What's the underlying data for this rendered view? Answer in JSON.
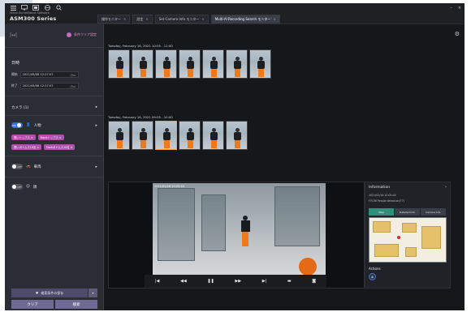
{
  "app": {
    "vendor": "Video Surveillance Software",
    "product": "ASM300 Series"
  },
  "tabs": [
    {
      "label": "操作モニター"
    },
    {
      "label": "設定"
    },
    {
      "label": "Set Camera Info モニター"
    },
    {
      "label": "Multi-AI Recording Search モニター"
    }
  ],
  "left_panel": {
    "clear_conditions": "条件クリア設定",
    "datetime_heading": "日時",
    "start_label": "開始",
    "start_value": "2021/08/08   12:27:07",
    "end_label": "終了",
    "end_value": "2021/08/08   12:27:07",
    "camera_label": "カメラ (1)",
    "person": {
      "toggle": "ON",
      "label": "人物"
    },
    "chips": [
      {
        "label": "黒いトップス ×"
      },
      {
        "label": "Blackトップス ×"
      },
      {
        "label": "黒いボトムス10名 ×"
      },
      {
        "label": "Darkボトムス10名 ×"
      }
    ],
    "vehicle": {
      "toggle": "OFF",
      "label": "車両"
    },
    "face": {
      "toggle": "OFF",
      "label": "顔"
    },
    "save_conditions": "検索条件の保存",
    "clear_button": "クリア",
    "search_button": "検索"
  },
  "results": {
    "group1_header": "Tuesday, February 16, 2021 10:05 - 11:00",
    "group2_header": "Tuesday, February 16, 2021 09:05 - 10:00",
    "group1_count": 7,
    "group2_count": 6
  },
  "player": {
    "timestamp": "2021/02/16 10:05:44"
  },
  "info": {
    "title": "Information",
    "line1": "2021/02/16 10:05:44",
    "line2": "FY108 People detection(T7)",
    "tabs": [
      {
        "label": "Map"
      },
      {
        "label": "Detailed Info"
      },
      {
        "label": "Camera Info"
      }
    ],
    "actions_label": "Actions"
  },
  "colors": {
    "accent_magenta": "#b04fae",
    "accent_teal": "#2f8f7c",
    "toggle_on": "#3a6fd8"
  }
}
